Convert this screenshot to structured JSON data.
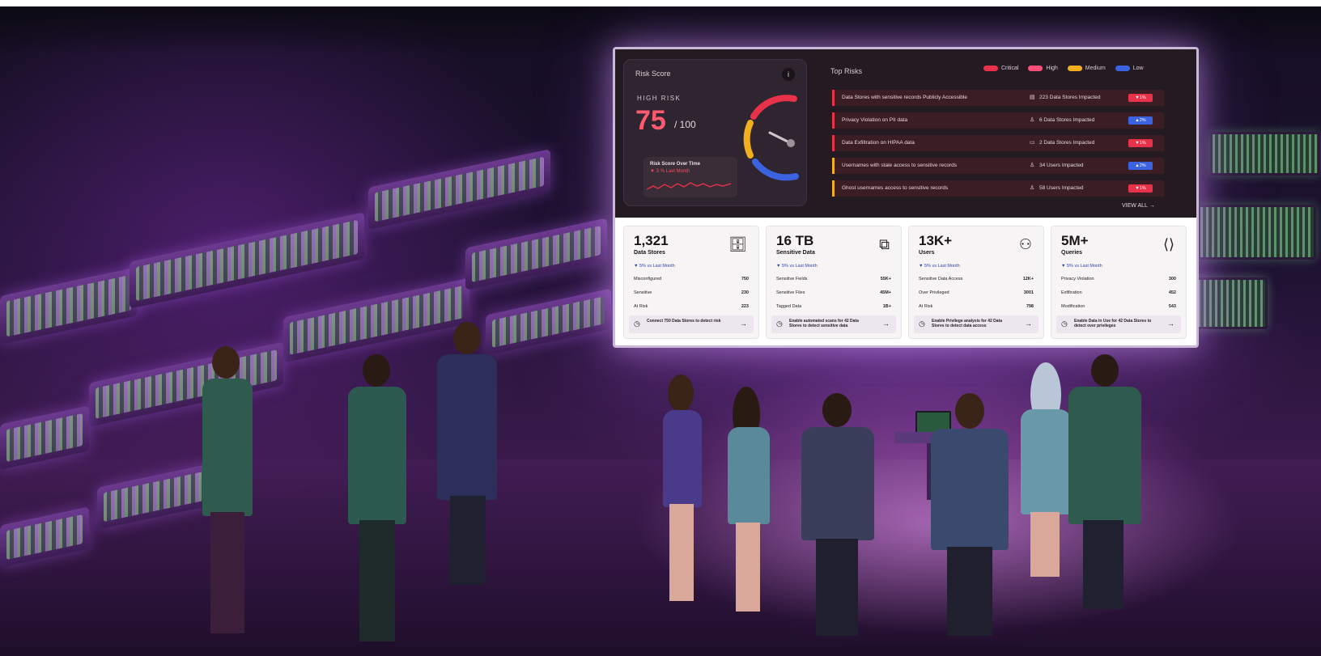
{
  "dashboard": {
    "risk_score": {
      "title": "Risk Score",
      "level": "HIGH RISK",
      "score": "75",
      "out_of": "/ 100",
      "gauge_value": 0.75,
      "over_time_title": "Risk Score Over Time",
      "over_time_delta": "▼ 3 % Last Month"
    },
    "top_risks": {
      "title": "Top Risks",
      "legend": [
        {
          "label": "Critical",
          "color": "#e8324a"
        },
        {
          "label": "High",
          "color": "#ff4f7a"
        },
        {
          "label": "Medium",
          "color": "#f2b01e"
        },
        {
          "label": "Low",
          "color": "#3b63e0"
        }
      ],
      "rows": [
        {
          "text": "Data Stores with sensitive records Publicly Accessible",
          "icon": "database-icon",
          "impact": "223 Data Stores Impacted",
          "badge": "▼1%",
          "bar_color": "#e8324a",
          "badge_color": "#e8324a"
        },
        {
          "text": "Privacy Violation on PII data",
          "icon": "user-icon",
          "impact": "6 Data Stores Impacted",
          "badge": "▲2%",
          "bar_color": "#e8324a",
          "badge_color": "#3b63e0"
        },
        {
          "text": "Data Exfiltration on HIPAA data",
          "icon": "monitor-icon",
          "impact": "2 Data Stores Impacted",
          "badge": "▼1%",
          "bar_color": "#e8324a",
          "badge_color": "#e8324a"
        },
        {
          "text": "Usernames with stale access to sensitive records",
          "icon": "user-icon",
          "impact": "34 Users Impacted",
          "badge": "▲2%",
          "bar_color": "#f2b01e",
          "badge_color": "#3b63e0"
        },
        {
          "text": "Ghost usernames access to sensitive records",
          "icon": "user-icon",
          "impact": "58 Users Impacted",
          "badge": "▼1%",
          "bar_color": "#f2b01e",
          "badge_color": "#e8324a"
        }
      ],
      "view_all": "VIEW ALL →"
    },
    "stats": [
      {
        "value": "1,321",
        "label": "Data Stores",
        "icon": "database-icon",
        "icon_glyph": "🗄",
        "delta": "▼ 5% vs Last Month",
        "rows": [
          {
            "k": "Misconfigured",
            "v": "750"
          },
          {
            "k": "Sensitive",
            "v": "230"
          },
          {
            "k": "At Risk",
            "v": "223"
          }
        ],
        "cta": "Connect 750 Data Stores to detect risk"
      },
      {
        "value": "16 TB",
        "label": "Sensitive Data",
        "icon": "data-flow-icon",
        "icon_glyph": "⧉",
        "delta": "▼ 5% vs Last Month",
        "rows": [
          {
            "k": "Sensitive Fields",
            "v": "55K+"
          },
          {
            "k": "Sensitive Files",
            "v": "45M+"
          },
          {
            "k": "Tagged Data",
            "v": "1B+"
          }
        ],
        "cta": "Enable automated scans for 42 Data Stores to detect sensitive data"
      },
      {
        "value": "13K+",
        "label": "Users",
        "icon": "users-icon",
        "icon_glyph": "👥",
        "delta": "▼ 5% vs Last Month",
        "rows": [
          {
            "k": "Sensitive Data Access",
            "v": "12K+"
          },
          {
            "k": "Over Privileged",
            "v": "3001"
          },
          {
            "k": "At Risk",
            "v": "798"
          }
        ],
        "cta": "Enable Privilege analysis for 42 Data Stores to detect data access"
      },
      {
        "value": "5M+",
        "label": "Queries",
        "icon": "code-file-icon",
        "icon_glyph": "⟨⟩",
        "delta": "▼ 5% vs Last Month",
        "rows": [
          {
            "k": "Privacy Violation",
            "v": "300"
          },
          {
            "k": "Exfiltration",
            "v": "452"
          },
          {
            "k": "Modification",
            "v": "543"
          }
        ],
        "cta": "Enable Data in Use for 42 Data Stores to detect over privileges"
      }
    ]
  }
}
